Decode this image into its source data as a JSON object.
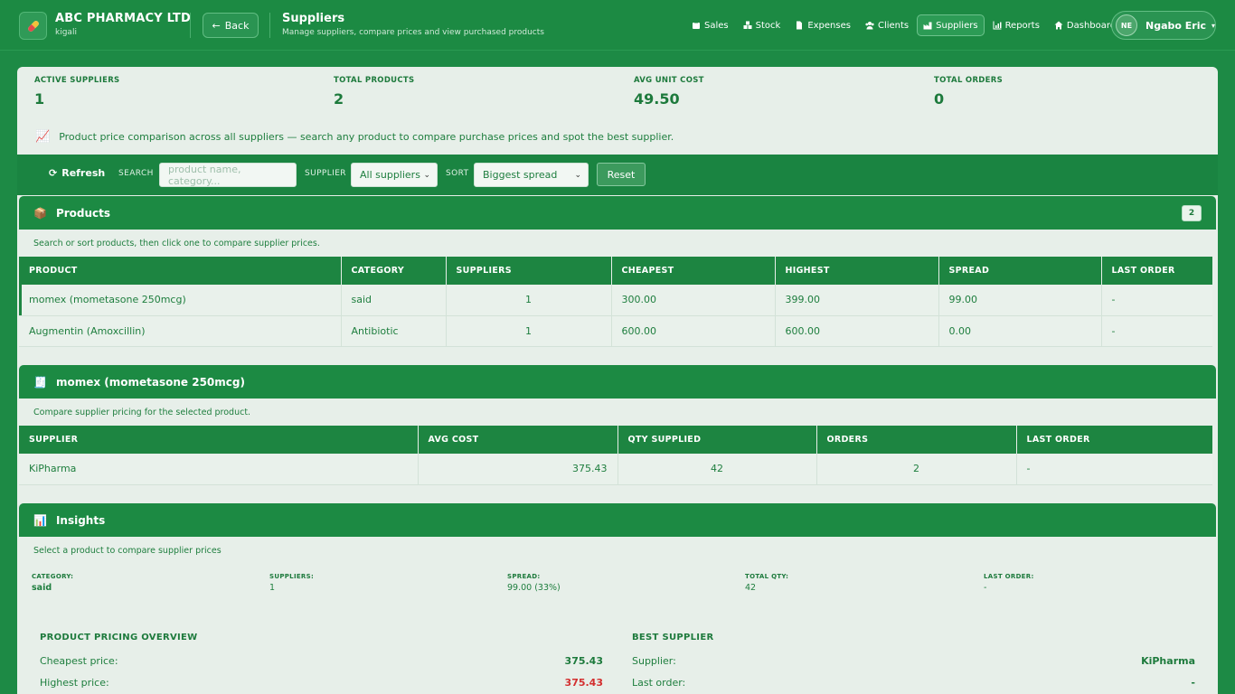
{
  "brand": {
    "name": "ABC PHARMACY LTD",
    "location": "kigali",
    "logo_icon": "pill-icon"
  },
  "header": {
    "back_label": "Back",
    "title": "Suppliers",
    "subtitle": "Manage suppliers, compare prices and view purchased products"
  },
  "nav": {
    "items": [
      {
        "label": "Sales",
        "icon": "sales-icon"
      },
      {
        "label": "Stock",
        "icon": "stock-icon"
      },
      {
        "label": "Expenses",
        "icon": "expenses-icon"
      },
      {
        "label": "Clients",
        "icon": "clients-icon"
      },
      {
        "label": "Suppliers",
        "icon": "suppliers-icon",
        "active": true
      },
      {
        "label": "Reports",
        "icon": "reports-icon"
      },
      {
        "label": "Dashboard",
        "icon": "home-icon"
      }
    ]
  },
  "user": {
    "initials": "NE",
    "name": "Ngabo Eric",
    "caret": "▾"
  },
  "stats": [
    {
      "label": "ACTIVE SUPPLIERS",
      "value": "1"
    },
    {
      "label": "TOTAL PRODUCTS",
      "value": "2"
    },
    {
      "label": "AVG UNIT COST",
      "value": "49.50"
    },
    {
      "label": "TOTAL ORDERS",
      "value": "0"
    }
  ],
  "info_text": "Product price comparison across all suppliers — search any product to compare purchase prices and spot the best supplier.",
  "toolbar": {
    "refresh_label": "Refresh",
    "search_label": "SEARCH",
    "search_placeholder": "product name, category...",
    "supplier_label": "SUPPLIER",
    "supplier_value": "All suppliers",
    "sort_label": "SORT",
    "sort_value": "Biggest spread",
    "reset_label": "Reset"
  },
  "products": {
    "title": "Products",
    "count": "2",
    "hint": "Search or sort products, then click one to compare supplier prices.",
    "columns": [
      "PRODUCT",
      "CATEGORY",
      "SUPPLIERS",
      "CHEAPEST",
      "HIGHEST",
      "SPREAD",
      "LAST ORDER"
    ],
    "rows": [
      {
        "product": "momex (mometasone 250mcg)",
        "category": "said",
        "suppliers": "1",
        "cheapest": "300.00",
        "highest": "399.00",
        "spread": "99.00",
        "last_order": "-"
      },
      {
        "product": "Augmentin (Amoxcillin)",
        "category": "Antibiotic",
        "suppliers": "1",
        "cheapest": "600.00",
        "highest": "600.00",
        "spread": "0.00",
        "last_order": "-"
      }
    ]
  },
  "selected": {
    "title": "momex (mometasone 250mcg)",
    "hint": "Compare supplier pricing for the selected product.",
    "columns": [
      "SUPPLIER",
      "AVG COST",
      "QTY SUPPLIED",
      "ORDERS",
      "LAST ORDER"
    ],
    "rows": [
      {
        "supplier": "KiPharma",
        "avg_cost": "375.43",
        "qty": "42",
        "orders": "2",
        "last_order": "-"
      }
    ]
  },
  "insights": {
    "title": "Insights",
    "hint": "Select a product to compare supplier prices",
    "fields": [
      {
        "label": "CATEGORY:",
        "value": "said"
      },
      {
        "label": "SUPPLIERS:",
        "value": "1"
      },
      {
        "label": "SPREAD:",
        "value": "99.00 (33%)"
      },
      {
        "label": "TOTAL QTY:",
        "value": "42"
      },
      {
        "label": "LAST ORDER:",
        "value": "-"
      }
    ],
    "pricing_title": "PRODUCT PRICING OVERVIEW",
    "cheapest_label": "Cheapest price:",
    "cheapest_value": "375.43",
    "highest_label": "Highest price:",
    "highest_value": "375.43",
    "best_title": "BEST SUPPLIER",
    "supplier_label": "Supplier:",
    "supplier_value": "KiPharma",
    "last_order_label": "Last order:",
    "last_order_value": "-"
  },
  "colors": {
    "primary": "#1c8a43",
    "panel": "#e7efe9",
    "text": "#1e7e3e",
    "danger": "#d32f2f"
  }
}
